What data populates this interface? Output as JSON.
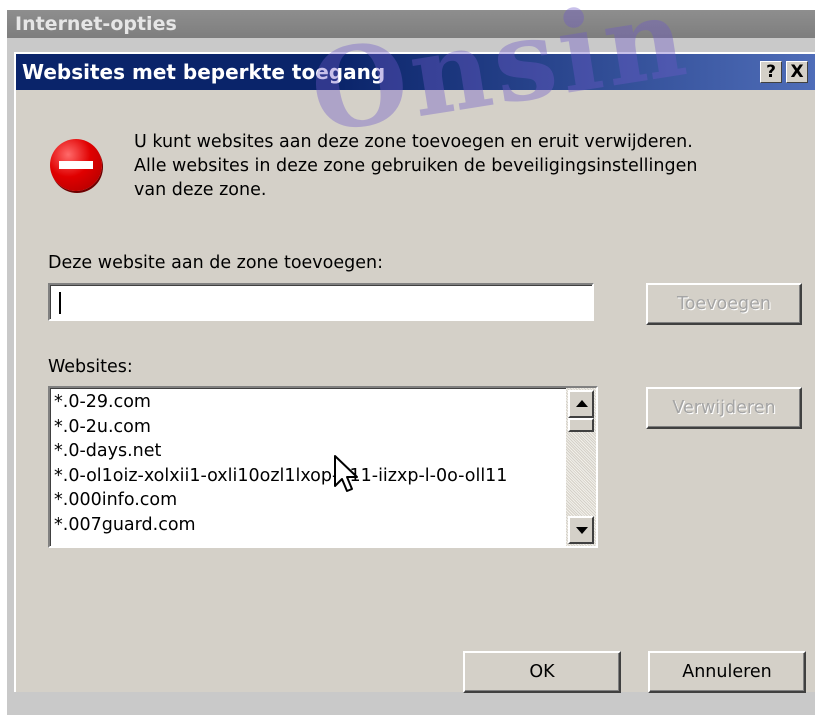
{
  "outer_window": {
    "title": "Internet-opties"
  },
  "dialog": {
    "title": "Websites met beperkte toegang",
    "help_button": "?",
    "close_button": "X"
  },
  "watermark": "Onsin",
  "info": {
    "icon": "restricted-stop-icon",
    "lines": [
      "U kunt websites aan deze zone toevoegen en eruit verwijderen.",
      "Alle websites in deze zone gebruiken de beveiligingsinstellingen",
      "van deze zone."
    ]
  },
  "add_site": {
    "label": "Deze website aan de zone toevoegen:",
    "value": "",
    "button": "Toevoegen"
  },
  "websites": {
    "label": "Websites:",
    "items": [
      "*.0-29.com",
      "*.0-2u.com",
      "*.0-days.net",
      "*.0-ol1oiz-xolxii1-oxli10ozl1lxop-l-11-iizxp-l-0o-oll11",
      "*.000info.com",
      "*.007guard.com"
    ],
    "remove_button": "Verwijderen"
  },
  "footer": {
    "ok": "OK",
    "cancel": "Annuleren"
  },
  "colors": {
    "titlebar_active": "#0a246a",
    "dialog_face": "#d4d0c8",
    "stop_icon_red": "#e00000"
  }
}
